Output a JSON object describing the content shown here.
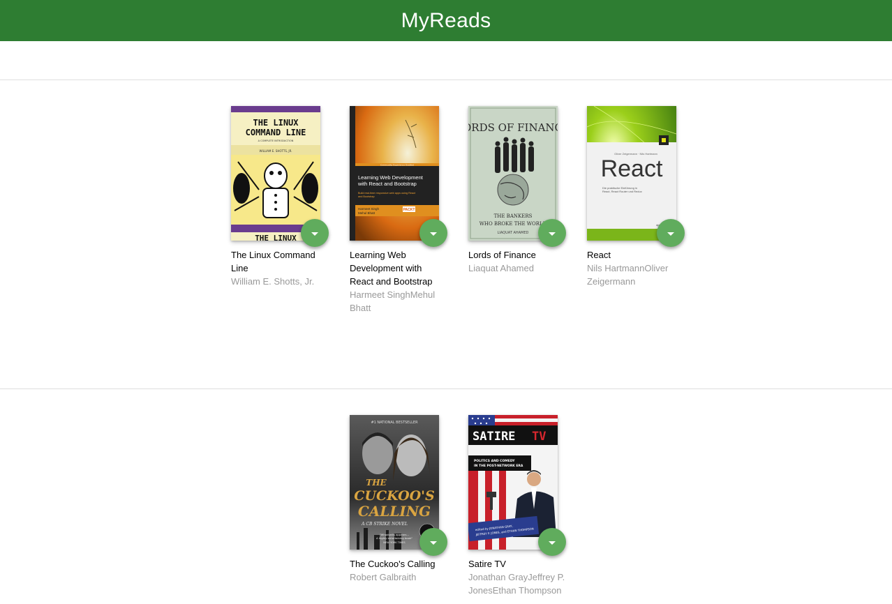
{
  "app": {
    "title": "MyReads"
  },
  "colors": {
    "header": "#2e7d32",
    "shelf_changer": "#60ac5d"
  },
  "shelves": [
    {
      "books": [
        {
          "title": "The Linux Command Line",
          "authors": "William E. Shotts, Jr.",
          "cover": {
            "line1": "THE LINUX",
            "line2": "COMMAND LINE",
            "subtitle": "A COMPLETE INTRODUCTION",
            "author": "WILLIAM E. SHOTTS, JR.",
            "footer": "THE LINUX"
          }
        },
        {
          "title": "Learning Web Development with React and Bootstrap",
          "authors": "Harmeet SinghMehul Bhatt",
          "cover": {
            "line1": "Learning Web Development",
            "line2": "with React and Bootstrap",
            "tagline1": "Build real-time responsive web apps using React",
            "tagline2": "and Bootstrap",
            "author1": "Harmeet Singh",
            "author2": "Mehul Bhatt",
            "publisher": "PACKT",
            "band": "Community Experience Distilled"
          }
        },
        {
          "title": "Lords of Finance",
          "authors": "Liaquat Ahamed",
          "cover": {
            "line1": "LORDS OF FINANCE",
            "sub1": "THE BANKERS",
            "sub2": "WHO BROKE THE WORLD",
            "author": "LIAQUAT AHAMED"
          }
        },
        {
          "title": "React",
          "authors": "Nils HartmannOliver Zeigermann",
          "cover": {
            "authors": "Oliver Zeigermann · Nils Hartmann",
            "title": "React",
            "sub1": "Die praktische Einführung in",
            "sub2": "React, React Router und Redux",
            "publisher": "dpunkt.verlag"
          }
        }
      ]
    },
    {
      "books": [
        {
          "title": "The Cuckoo's Calling",
          "authors": "Robert Galbraith",
          "cover": {
            "top": "#1 NATIONAL BESTSELLER",
            "line1": "THE",
            "line2": "CUCKOO'S",
            "line3": "CALLING",
            "sub": "A CB STRIKE NOVEL",
            "quote1": "\"Whodunits appears...",
            "quote2": "A highly entertaining book\"",
            "quote3": "NEW YORK TIMES"
          }
        },
        {
          "title": "Satire TV",
          "authors": "Jonathan GrayJeffrey P. JonesEthan Thompson",
          "cover": {
            "line1": "SATIRE",
            "line2": "TV",
            "sub1": "POLITICS AND COMEDY",
            "sub2": "IN THE POST-NETWORK ERA",
            "editors1": "edited by JONATHAN GRAY,",
            "editors2": "JEFFREY P. JONES, and ETHAN THOMPSON"
          }
        }
      ]
    }
  ]
}
